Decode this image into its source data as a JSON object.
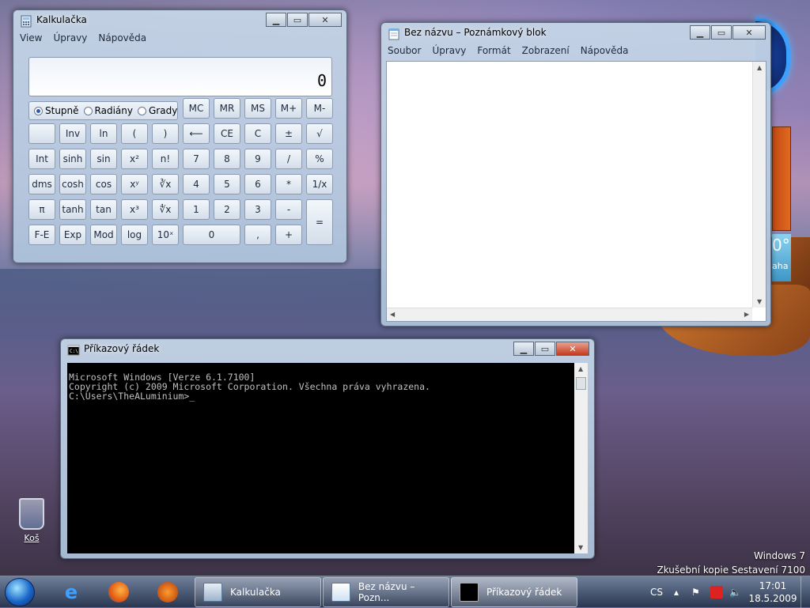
{
  "calculator": {
    "title": "Kalkulačka",
    "menu": [
      "View",
      "Úpravy",
      "Nápověda"
    ],
    "display": "0",
    "angle_modes": [
      "Stupně",
      "Radiány",
      "Grady"
    ],
    "memory_keys": [
      "MC",
      "MR",
      "MS",
      "M+",
      "M-"
    ],
    "rows": [
      [
        "",
        "Inv",
        "ln",
        "(",
        ")",
        "⟵",
        "CE",
        "C",
        "±",
        "√"
      ],
      [
        "Int",
        "sinh",
        "sin",
        "x²",
        "n!",
        "7",
        "8",
        "9",
        "/",
        "%"
      ],
      [
        "dms",
        "cosh",
        "cos",
        "xʸ",
        "∛x",
        "4",
        "5",
        "6",
        "*",
        "1/x"
      ],
      [
        "π",
        "tanh",
        "tan",
        "x³",
        "∜x",
        "1",
        "2",
        "3",
        "-",
        "="
      ],
      [
        "F-E",
        "Exp",
        "Mod",
        "log",
        "10ˣ",
        "0",
        ",",
        "+"
      ]
    ]
  },
  "notepad": {
    "title": "Bez názvu – Poznámkový blok",
    "menu": [
      "Soubor",
      "Úpravy",
      "Formát",
      "Zobrazení",
      "Nápověda"
    ],
    "content": ""
  },
  "cmd": {
    "title": "Příkazový řádek",
    "lines": [
      "Microsoft Windows [Verze 6.1.7100]",
      "Copyright (c) 2009 Microsoft Corporation. Všechna práva vyhrazena.",
      "",
      "C:\\Users\\TheALuminium>_"
    ]
  },
  "desktop": {
    "recycle_bin": "Koš",
    "watermark_line1": "Windows 7",
    "watermark_line2": "Zkušební kopie Sestavení 7100",
    "weather_temp": "0°",
    "weather_city": "aha"
  },
  "taskbar": {
    "tasks": [
      "Kalkulačka",
      "Bez názvu – Pozn...",
      "Příkazový řádek"
    ],
    "language": "CS",
    "time": "17:01",
    "date": "18.5.2009"
  },
  "colors": {
    "accent": "#1a66c9",
    "cmd_bg": "#000000",
    "cmd_fg": "#c0c0c0"
  }
}
